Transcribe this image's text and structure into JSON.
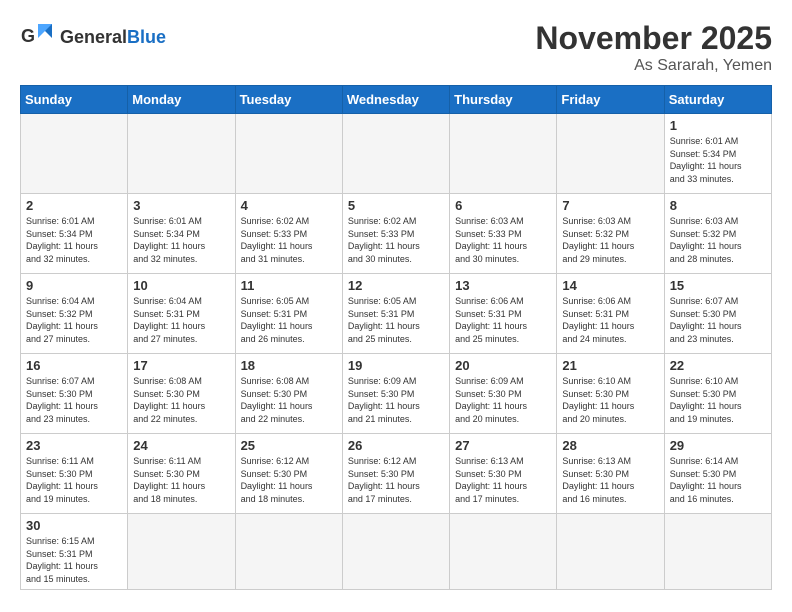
{
  "logo": {
    "general": "General",
    "blue": "Blue"
  },
  "header": {
    "month_year": "November 2025",
    "location": "As Sararah, Yemen"
  },
  "weekdays": [
    "Sunday",
    "Monday",
    "Tuesday",
    "Wednesday",
    "Thursday",
    "Friday",
    "Saturday"
  ],
  "days": [
    {
      "date": "",
      "info": ""
    },
    {
      "date": "",
      "info": ""
    },
    {
      "date": "",
      "info": ""
    },
    {
      "date": "",
      "info": ""
    },
    {
      "date": "",
      "info": ""
    },
    {
      "date": "",
      "info": ""
    },
    {
      "date": "1",
      "info": "Sunrise: 6:01 AM\nSunset: 5:34 PM\nDaylight: 11 hours\nand 33 minutes."
    },
    {
      "date": "2",
      "info": "Sunrise: 6:01 AM\nSunset: 5:34 PM\nDaylight: 11 hours\nand 32 minutes."
    },
    {
      "date": "3",
      "info": "Sunrise: 6:01 AM\nSunset: 5:34 PM\nDaylight: 11 hours\nand 32 minutes."
    },
    {
      "date": "4",
      "info": "Sunrise: 6:02 AM\nSunset: 5:33 PM\nDaylight: 11 hours\nand 31 minutes."
    },
    {
      "date": "5",
      "info": "Sunrise: 6:02 AM\nSunset: 5:33 PM\nDaylight: 11 hours\nand 30 minutes."
    },
    {
      "date": "6",
      "info": "Sunrise: 6:03 AM\nSunset: 5:33 PM\nDaylight: 11 hours\nand 30 minutes."
    },
    {
      "date": "7",
      "info": "Sunrise: 6:03 AM\nSunset: 5:32 PM\nDaylight: 11 hours\nand 29 minutes."
    },
    {
      "date": "8",
      "info": "Sunrise: 6:03 AM\nSunset: 5:32 PM\nDaylight: 11 hours\nand 28 minutes."
    },
    {
      "date": "9",
      "info": "Sunrise: 6:04 AM\nSunset: 5:32 PM\nDaylight: 11 hours\nand 27 minutes."
    },
    {
      "date": "10",
      "info": "Sunrise: 6:04 AM\nSunset: 5:31 PM\nDaylight: 11 hours\nand 27 minutes."
    },
    {
      "date": "11",
      "info": "Sunrise: 6:05 AM\nSunset: 5:31 PM\nDaylight: 11 hours\nand 26 minutes."
    },
    {
      "date": "12",
      "info": "Sunrise: 6:05 AM\nSunset: 5:31 PM\nDaylight: 11 hours\nand 25 minutes."
    },
    {
      "date": "13",
      "info": "Sunrise: 6:06 AM\nSunset: 5:31 PM\nDaylight: 11 hours\nand 25 minutes."
    },
    {
      "date": "14",
      "info": "Sunrise: 6:06 AM\nSunset: 5:31 PM\nDaylight: 11 hours\nand 24 minutes."
    },
    {
      "date": "15",
      "info": "Sunrise: 6:07 AM\nSunset: 5:30 PM\nDaylight: 11 hours\nand 23 minutes."
    },
    {
      "date": "16",
      "info": "Sunrise: 6:07 AM\nSunset: 5:30 PM\nDaylight: 11 hours\nand 23 minutes."
    },
    {
      "date": "17",
      "info": "Sunrise: 6:08 AM\nSunset: 5:30 PM\nDaylight: 11 hours\nand 22 minutes."
    },
    {
      "date": "18",
      "info": "Sunrise: 6:08 AM\nSunset: 5:30 PM\nDaylight: 11 hours\nand 22 minutes."
    },
    {
      "date": "19",
      "info": "Sunrise: 6:09 AM\nSunset: 5:30 PM\nDaylight: 11 hours\nand 21 minutes."
    },
    {
      "date": "20",
      "info": "Sunrise: 6:09 AM\nSunset: 5:30 PM\nDaylight: 11 hours\nand 20 minutes."
    },
    {
      "date": "21",
      "info": "Sunrise: 6:10 AM\nSunset: 5:30 PM\nDaylight: 11 hours\nand 20 minutes."
    },
    {
      "date": "22",
      "info": "Sunrise: 6:10 AM\nSunset: 5:30 PM\nDaylight: 11 hours\nand 19 minutes."
    },
    {
      "date": "23",
      "info": "Sunrise: 6:11 AM\nSunset: 5:30 PM\nDaylight: 11 hours\nand 19 minutes."
    },
    {
      "date": "24",
      "info": "Sunrise: 6:11 AM\nSunset: 5:30 PM\nDaylight: 11 hours\nand 18 minutes."
    },
    {
      "date": "25",
      "info": "Sunrise: 6:12 AM\nSunset: 5:30 PM\nDaylight: 11 hours\nand 18 minutes."
    },
    {
      "date": "26",
      "info": "Sunrise: 6:12 AM\nSunset: 5:30 PM\nDaylight: 11 hours\nand 17 minutes."
    },
    {
      "date": "27",
      "info": "Sunrise: 6:13 AM\nSunset: 5:30 PM\nDaylight: 11 hours\nand 17 minutes."
    },
    {
      "date": "28",
      "info": "Sunrise: 6:13 AM\nSunset: 5:30 PM\nDaylight: 11 hours\nand 16 minutes."
    },
    {
      "date": "29",
      "info": "Sunrise: 6:14 AM\nSunset: 5:30 PM\nDaylight: 11 hours\nand 16 minutes."
    },
    {
      "date": "30",
      "info": "Sunrise: 6:15 AM\nSunset: 5:31 PM\nDaylight: 11 hours\nand 15 minutes."
    },
    {
      "date": "",
      "info": ""
    },
    {
      "date": "",
      "info": ""
    },
    {
      "date": "",
      "info": ""
    },
    {
      "date": "",
      "info": ""
    },
    {
      "date": "",
      "info": ""
    },
    {
      "date": "",
      "info": ""
    }
  ]
}
